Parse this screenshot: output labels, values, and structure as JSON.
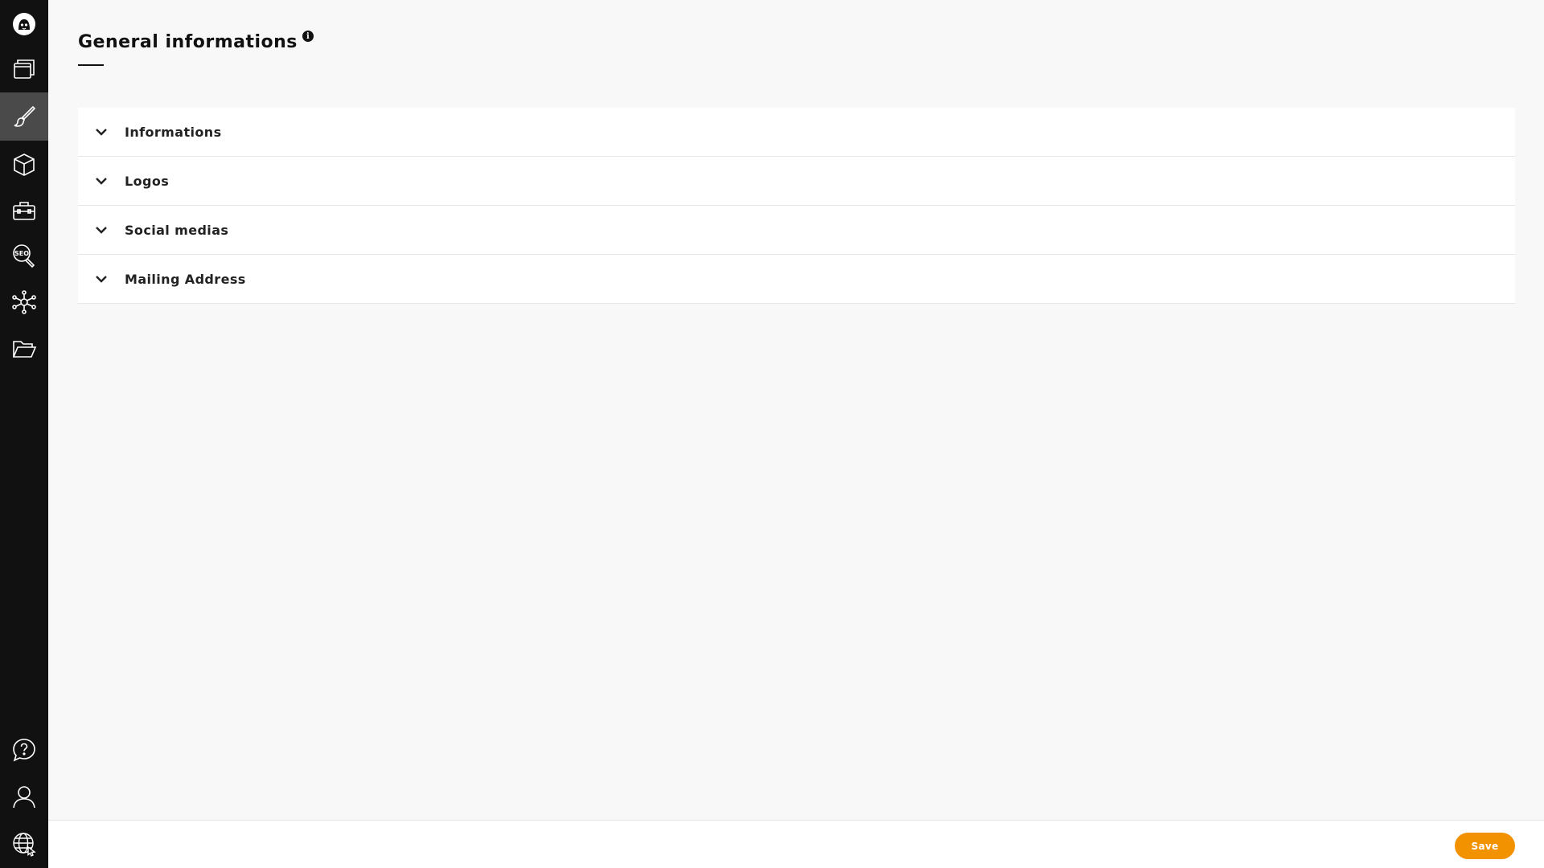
{
  "sidebar": {
    "top_items": [
      {
        "icon": "logo-icon"
      },
      {
        "icon": "windows-icon"
      },
      {
        "icon": "brush-icon",
        "active": true
      },
      {
        "icon": "cube-icon"
      },
      {
        "icon": "toolbox-icon"
      },
      {
        "icon": "seo-search-icon",
        "icon_text": "SEO"
      },
      {
        "icon": "network-icon"
      },
      {
        "icon": "folder-open-icon"
      }
    ],
    "bottom_items": [
      {
        "icon": "help-chat-icon"
      },
      {
        "icon": "user-icon"
      },
      {
        "icon": "globe-icon"
      }
    ]
  },
  "header": {
    "title": "General informations",
    "info_icon": "i"
  },
  "accordion": {
    "sections": [
      {
        "label": "Informations"
      },
      {
        "label": "Logos"
      },
      {
        "label": "Social medias"
      },
      {
        "label": "Mailing Address"
      }
    ]
  },
  "footer": {
    "save_label": "Save"
  },
  "colors": {
    "sidebar_bg": "#111111",
    "sidebar_active": "#4a4a4a",
    "page_bg": "#f8f8f8",
    "accent": "#f39200"
  }
}
